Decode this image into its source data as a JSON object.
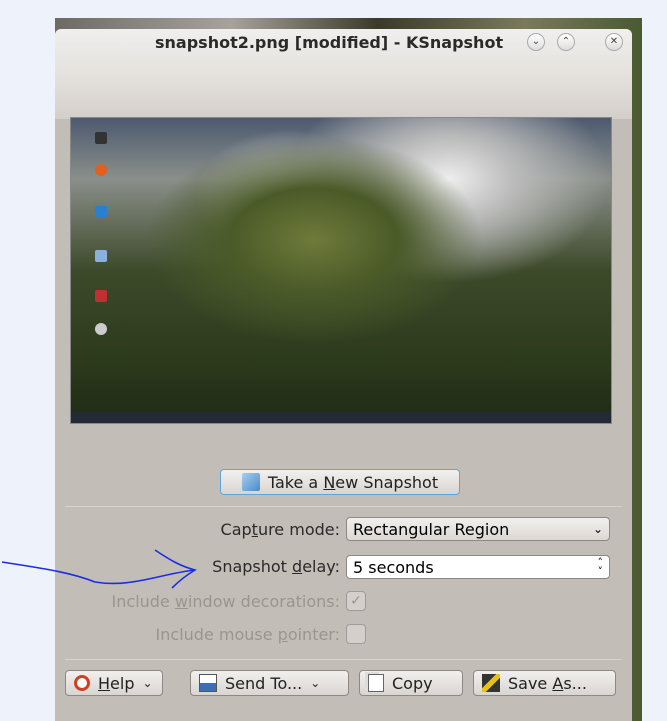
{
  "window": {
    "title": "snapshot2.png [modified] - KSnapshot",
    "minimize_icon": "chevron-down-circle",
    "maximize_icon": "chevron-up-circle",
    "close_icon": "x-circle"
  },
  "preview": {
    "alt": "desktop screenshot preview"
  },
  "take_snapshot": {
    "label_pre": "Take a ",
    "label_u": "N",
    "label_post": "ew Snapshot",
    "icon": "snapshot-icon"
  },
  "form": {
    "capture_mode": {
      "label_pre": "Cap",
      "label_u": "t",
      "label_post": "ure mode:",
      "value": "Rectangular Region"
    },
    "snapshot_delay": {
      "label_pre": "Snapshot ",
      "label_u": "d",
      "label_post": "elay:",
      "value": "5 seconds"
    },
    "include_decorations": {
      "label_pre": "Include ",
      "label_u": "w",
      "label_post": "indow decorations:",
      "checked": true,
      "disabled": true
    },
    "include_pointer": {
      "label_pre": "Include mouse ",
      "label_u": "p",
      "label_post": "ointer:",
      "checked": false,
      "disabled": true
    }
  },
  "buttons": {
    "help": {
      "label_u": "H",
      "label_post": "elp"
    },
    "send_to": {
      "label": "Send To..."
    },
    "copy": {
      "label": "Copy"
    },
    "save_as": {
      "label_pre": "Save ",
      "label_u": "A",
      "label_post": "s..."
    }
  },
  "annotation": {
    "color": "#1a2ee0"
  }
}
